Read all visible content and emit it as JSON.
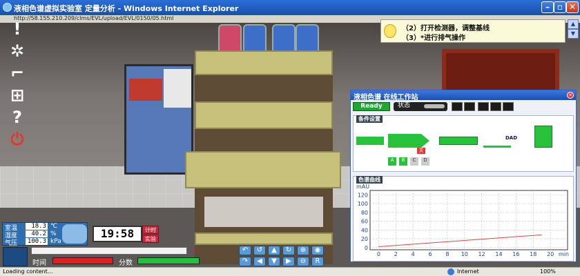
{
  "window": {
    "title": "液相色谱虚拟实验室 定量分析 - Windows Internet Explorer",
    "address": "http://58.155.210.209/clms/EVL/upload/EVL/0150/05.html"
  },
  "hint": {
    "line1": "（2）打开检测器，调整基线",
    "line2": "（3）*进行排气操作"
  },
  "workstation": {
    "title": "液相色谱 在线工作站",
    "ready": "Ready",
    "status_label": "状态",
    "conditions_caption": "条件设置",
    "chromatogram_caption": "色谱曲线",
    "detector_label": "DAD",
    "pump_flags": [
      "A",
      "B",
      "C",
      "D"
    ],
    "valve_label": "关"
  },
  "chart_data": {
    "type": "line",
    "ylabel": "mAU",
    "xlabel": "min",
    "xticks": [
      0,
      2,
      4,
      6,
      8,
      10,
      12,
      14,
      16,
      18,
      20
    ],
    "yticks": [
      0,
      20,
      40,
      60,
      80,
      100,
      120
    ],
    "xlim": [
      -1,
      22
    ],
    "ylim": [
      -5,
      130
    ],
    "grid": true,
    "series": [
      {
        "x": [
          0,
          19
        ],
        "y": [
          2,
          29
        ]
      }
    ],
    "line_color": "#d94545"
  },
  "env": {
    "temp_label": "室温",
    "temp_value": "18.3",
    "temp_unit": "℃",
    "hum_label": "湿度",
    "hum_value": "40.2",
    "hum_unit": "%",
    "pres_label": "气压",
    "pres_value": "100.3",
    "pres_unit": "kPa"
  },
  "clock": {
    "time": "19:58",
    "timer_label": "计时",
    "lab_label": "实验"
  },
  "bars": {
    "time_label": "时间",
    "score_label": "分数",
    "time_fraction": 1.0,
    "score_fraction": 1.0
  },
  "statusbar": {
    "loading": "Loading content...",
    "zone": "Internet",
    "zoom": "100%"
  },
  "colors": {
    "ready": "#1fa830",
    "time_bar": "#e02020",
    "score_bar": "#22c040"
  }
}
